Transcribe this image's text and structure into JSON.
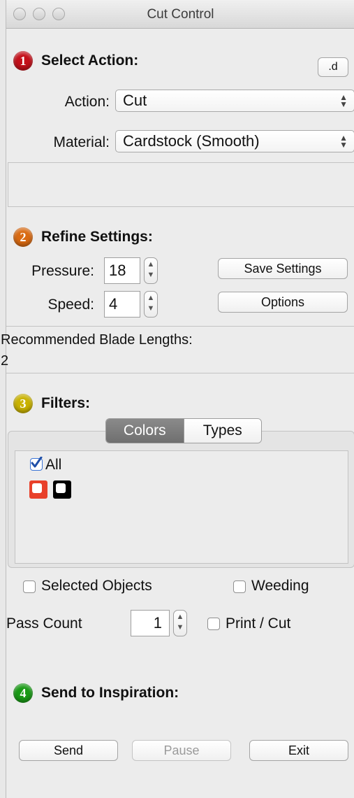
{
  "window": {
    "title": "Cut Control"
  },
  "step1": {
    "number": "1",
    "heading": "Select Action:",
    "corner_button": ".d",
    "action_label": "Action:",
    "action_value": "Cut",
    "material_label": "Material:",
    "material_value": "Cardstock (Smooth)"
  },
  "step2": {
    "number": "2",
    "heading": "Refine Settings:",
    "pressure_label": "Pressure:",
    "pressure_value": "18",
    "speed_label": "Speed:",
    "speed_value": "4",
    "save_settings": "Save Settings",
    "options": "Options",
    "blade_label": "Recommended Blade Lengths:",
    "blade_value": "2"
  },
  "step3": {
    "number": "3",
    "heading": "Filters:",
    "tabs": [
      {
        "label": "Colors",
        "selected": true
      },
      {
        "label": "Types",
        "selected": false
      }
    ],
    "all_label": "All",
    "all_checked": true,
    "color_swatches": [
      {
        "color": "#e8402a",
        "checked": false
      },
      {
        "color": "#000000",
        "checked": false
      }
    ],
    "selected_objects": "Selected Objects",
    "weeding": "Weeding",
    "pass_count_label": "Pass Count",
    "pass_count_value": "1",
    "print_cut": "Print / Cut"
  },
  "step4": {
    "number": "4",
    "heading": "Send to Inspiration:",
    "send": "Send",
    "pause": "Pause",
    "exit": "Exit"
  },
  "colors": {
    "step1_ball": "#c4101a",
    "step2_ball": "#d96a12",
    "step3_ball": "#c9b200",
    "step4_ball": "#1a9a16",
    "checkbox_accent": "#3a74d6"
  }
}
